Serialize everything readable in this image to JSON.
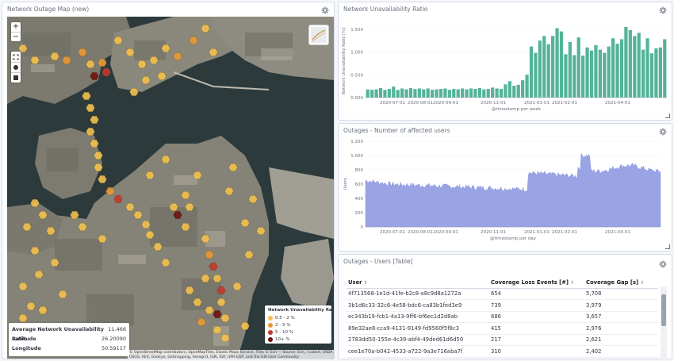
{
  "map_panel": {
    "title": "Network Outage Map (new)",
    "zoom_in": "+",
    "zoom_out": "−",
    "legend": {
      "title": "Network Unavailability Ratio",
      "items": [
        {
          "label": "0.5 - 2 %",
          "color": "#f2c14e"
        },
        {
          "label": "2 - 5 %",
          "color": "#e89934"
        },
        {
          "label": "5 - 10 %",
          "color": "#c0392b"
        },
        {
          "label": "10+ %",
          "color": "#6e1212"
        }
      ]
    },
    "tooltip": [
      {
        "key": "Average Network Unavailability Ratio",
        "value": "11.466"
      },
      {
        "key": "Latitude",
        "value": "26.20090"
      },
      {
        "key": "Longitude",
        "value": "50.59117"
      }
    ],
    "attribution": "© OpenStreetMap contributors, OpenMapTiles, Elastic Maps Service, Tiles © Esri — Source: Esri, i-cubed, USDA, USGS, AEX, GeoEye, Getmapping, Aerogrid, IGN, IGP, UPR-EGP, and the GIS User Community"
  },
  "ratio_panel": {
    "title": "Network Unavailability Ratio",
    "chart_data": {
      "type": "bar",
      "ylabel": "Network Unavailability Ratio [%]",
      "xlabel": "@timestamp per week",
      "ylim": [
        0,
        1.6
      ],
      "yticks": [
        "0.000",
        "0.500",
        "1.000",
        "1.500"
      ],
      "xticks": [
        "2020-07-01",
        "2020-08-01",
        "2020-09-01",
        "2020-11-01",
        "2021-01-01",
        "2021-02-01",
        "2021-04-01"
      ],
      "color": "#54b399",
      "values": [
        0.18,
        0.17,
        0.18,
        0.21,
        0.17,
        0.19,
        0.24,
        0.17,
        0.2,
        0.18,
        0.21,
        0.19,
        0.2,
        0.18,
        0.2,
        0.17,
        0.18,
        0.19,
        0.2,
        0.17,
        0.19,
        0.18,
        0.2,
        0.18,
        0.2,
        0.19,
        0.21,
        0.18,
        0.19,
        0.22,
        0.2,
        0.19,
        0.29,
        0.36,
        0.26,
        0.28,
        0.38,
        0.5,
        1.12,
        0.98,
        1.25,
        1.35,
        1.17,
        1.35,
        1.52,
        1.45,
        0.95,
        1.22,
        0.93,
        1.32,
        0.92,
        1.1,
        1.03,
        1.15,
        1.05,
        0.98,
        1.12,
        1.3,
        1.18,
        1.28,
        1.55,
        1.48,
        1.35,
        1.42,
        1.05,
        1.3,
        0.97,
        1.08,
        1.1,
        1.28
      ]
    }
  },
  "users_chart_panel": {
    "title": "Outages - Number of affected users",
    "chart_data": {
      "type": "area",
      "ylabel": "Users",
      "xlabel": "@timestamp per day",
      "ylim": [
        0,
        1200
      ],
      "yticks": [
        "0",
        "200",
        "400",
        "600",
        "800",
        "1,000",
        "1,200"
      ],
      "xticks": [
        "2020-07-01",
        "2020-08-01",
        "2020-09-01",
        "2020-11-01",
        "2021-01-01",
        "2021-02-01",
        "2021-04-01"
      ],
      "color": "#9aa4e4"
    }
  },
  "table_panel": {
    "title": "Outages - Users [Table]",
    "columns": [
      "User",
      "Coverage Loss Events [#]",
      "Coverage Gap [s]"
    ],
    "rows": [
      [
        "4f713568-1e1d-41fe-b2c8-a8c9d8a1272a",
        "654",
        "5,708"
      ],
      [
        "3b1d6c33-32c6-4e58-bdc6-ca83b1fed3e9",
        "739",
        "3,979"
      ],
      [
        "ec343b19-fcb1-4a13-9ff6-bf6ec1d2d8ab",
        "686",
        "3,657"
      ],
      [
        "89e32ae8-cca9-4131-9149-fd9560f5f8c3",
        "415",
        "2,976"
      ],
      [
        "2783dd50-155e-4c39-abf4-49ded61d6d50",
        "217",
        "2,621"
      ],
      [
        "cee1e70a-b042-4533-a722-9a3e716aba7f",
        "310",
        "2,402"
      ]
    ]
  }
}
